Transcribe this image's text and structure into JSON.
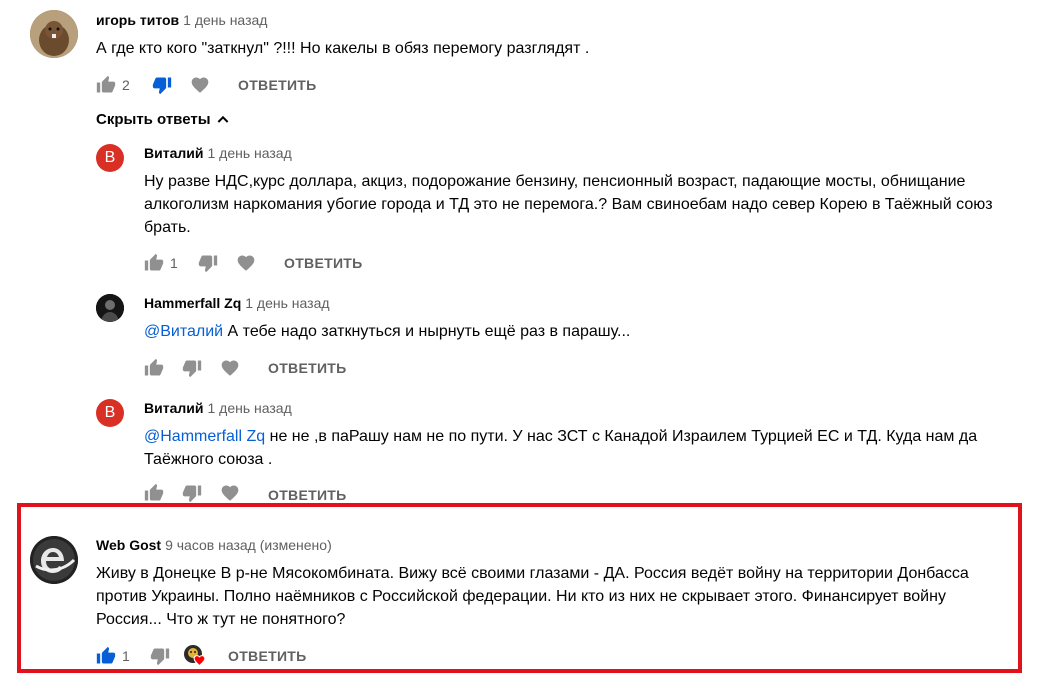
{
  "comment1": {
    "author": "игорь титов",
    "time": "1 день назад",
    "text": "А где кто кого \"заткнул\" ?!!! Но какелы в обяз перемогу разглядят .",
    "likes": "2",
    "reply_label": "ОТВЕТИТЬ"
  },
  "hide_replies_label": "Скрыть ответы",
  "reply1": {
    "author": "Виталий",
    "avatar_letter": "В",
    "time": "1 день назад",
    "text_line1": "Ну разве НДС,курс доллара, акциз, подорожание бензину, пенсионный возраст, падающие мосты,  обнищание",
    "text_line2": "алкоголизм наркомания убогие города и ТД это не перемога.? Вам свиноебам надо север Корею в Таёжный союз",
    "text_line3": "брать.",
    "likes": "1",
    "reply_label": "ОТВЕТИТЬ"
  },
  "reply2": {
    "author": "Hammerfall Zq",
    "time": "1 день назад",
    "mention": "@Виталий",
    "text": " А тебе надо заткнуться и нырнуть ещё раз в парашу...",
    "reply_label": "ОТВЕТИТЬ"
  },
  "reply3": {
    "author": "Виталий",
    "avatar_letter": "В",
    "time": "1 день назад",
    "mention": "@Hammerfall Zq",
    "text_line1": " не не ,в паРашу нам не по пути. У нас ЗСТ с Канадой Израилем Турцией ЕС и ТД. Куда нам да",
    "text_line2": "Таёжного союза .",
    "reply_label": "ОТВЕТИТЬ"
  },
  "comment2": {
    "author": "Web Gost",
    "time": "9 часов назад (изменено)",
    "text_line1": "Живу в Донецке В р-не Мясокомбината. Вижу всё своими глазами - ДА. Россия ведёт войну на территории Донбасса",
    "text_line2": "против Украины. Полно наёмников с Российской федерации. Ни кто из них не скрывает этого. Финансирует войну",
    "text_line3": "Россия... Что ж тут не понятного?",
    "likes": "1",
    "reply_label": "ОТВЕТИТЬ"
  },
  "colors": {
    "highlight_border": "#e0131a",
    "liked_blue": "#065fd4",
    "icon_gray": "#909090",
    "avatar_red": "#d93025"
  }
}
